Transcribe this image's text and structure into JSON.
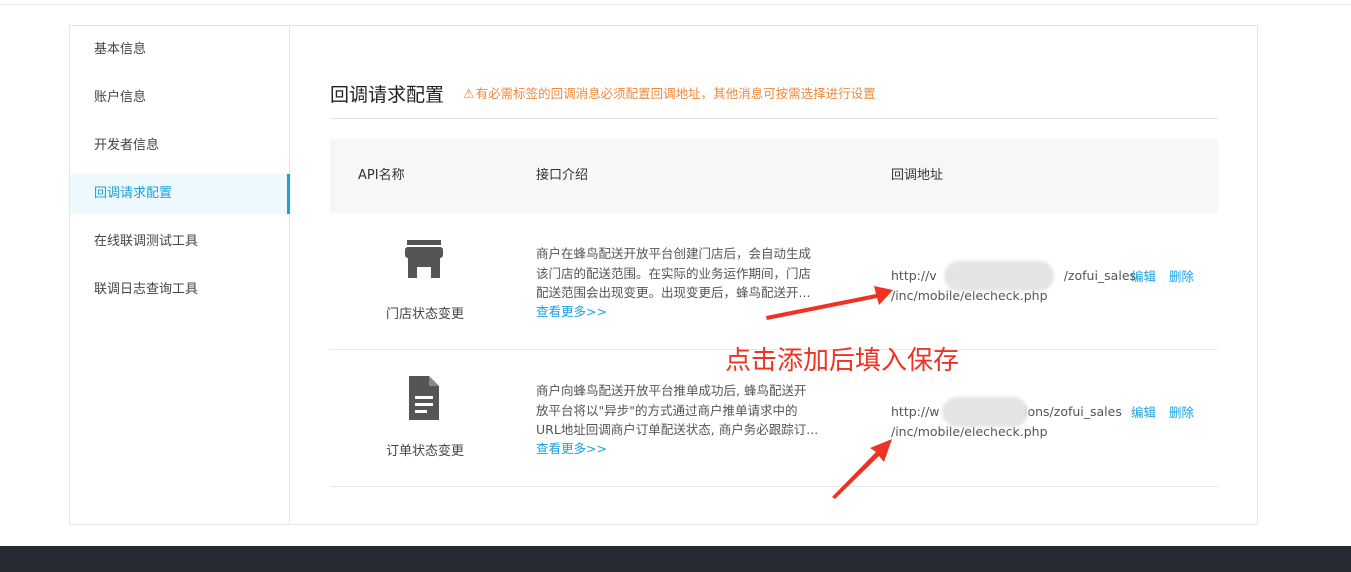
{
  "sidebar": {
    "items": [
      {
        "label": "基本信息"
      },
      {
        "label": "账户信息"
      },
      {
        "label": "开发者信息"
      },
      {
        "label": "回调请求配置"
      },
      {
        "label": "在线联调测试工具"
      },
      {
        "label": "联调日志查询工具"
      }
    ],
    "active_index": 3
  },
  "header": {
    "title": "回调请求配置",
    "warning_icon": "warning-triangle-icon",
    "warning_text": "有必需标签的回调消息必须配置回调地址，其他消息可按需选择进行设置"
  },
  "table": {
    "columns": [
      "API名称",
      "接口介绍",
      "回调地址"
    ],
    "rows": [
      {
        "icon": "store-icon",
        "name": "门店状态变更",
        "desc_lines": [
          "商户在蜂鸟配送开放平台创建门店后，会自动生成",
          "该门店的配送范围。在实际的业务运作期间，门店",
          "配送范围会出现变更。出现变更后，蜂鸟配送开..."
        ],
        "more": "查看更多>>",
        "url_line1_start": "http://v",
        "url_line1_end": "/zofui_sales",
        "url_line2": "/inc/mobile/elecheck.php",
        "edit": "编辑",
        "delete": "删除"
      },
      {
        "icon": "document-icon",
        "name": "订单状态变更",
        "desc_lines": [
          "商户向蜂鸟配送开放平台推单成功后, 蜂鸟配送开",
          "放平台将以\"异步\"的方式通过商户推单请求中的",
          "URL地址回调商户订单配送状态, 商户务必跟踪订..."
        ],
        "more": "查看更多>>",
        "url_line1_start": "http://w",
        "url_line1_end": "dons/zofui_sales",
        "url_line2": "/inc/mobile/elecheck.php",
        "edit": "编辑",
        "delete": "删除"
      }
    ]
  },
  "annotation": {
    "text": "点击添加后填入保存",
    "color": "#ee3325"
  },
  "colors": {
    "accent": "#1aa1e0",
    "warning": "#f0883a",
    "footer": "#262a33"
  }
}
